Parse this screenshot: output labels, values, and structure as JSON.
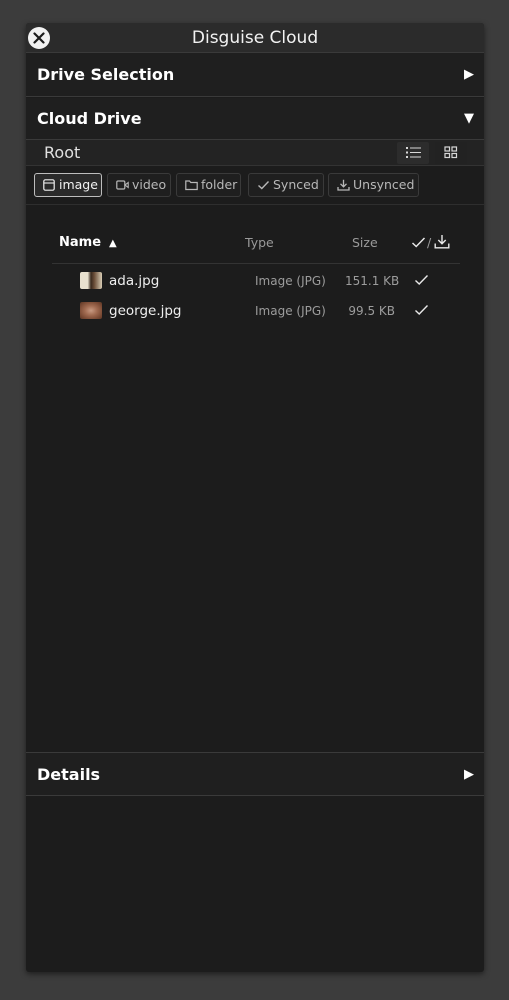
{
  "window": {
    "title": "Disguise Cloud",
    "close_icon": "close-icon"
  },
  "sections": {
    "drive_selection": {
      "label": "Drive Selection",
      "arrow": "▶",
      "state": "collapsed"
    },
    "cloud_drive": {
      "label": "Cloud Drive",
      "arrow": "▼",
      "state": "expanded"
    },
    "details": {
      "label": "Details",
      "arrow": "▶",
      "state": "collapsed"
    }
  },
  "breadcrumb": {
    "path": "Root",
    "selected_view": "list"
  },
  "view_buttons": [
    {
      "name": "list-view-icon"
    },
    {
      "name": "grid-view-icon"
    }
  ],
  "filters": [
    {
      "label": "image",
      "icon": "image-icon",
      "active": true
    },
    {
      "label": "video",
      "icon": "video-icon",
      "active": false
    },
    {
      "label": "folder",
      "icon": "folder-icon",
      "active": false
    },
    {
      "label": "Synced",
      "icon": "check-icon",
      "active": false
    },
    {
      "label": "Unsynced",
      "icon": "download-icon",
      "active": false
    }
  ],
  "table": {
    "headers": {
      "name": "Name",
      "sort": "▲",
      "type": "Type",
      "size": "Size",
      "sync_slash": "/"
    },
    "rows": [
      {
        "name": "ada.jpg",
        "type": "Image (JPG)",
        "size": "151.1 KB",
        "synced": true
      },
      {
        "name": "george.jpg",
        "type": "Image (JPG)",
        "size": "99.5 KB",
        "synced": true
      }
    ]
  },
  "colors": {
    "background": "#3c3c3c",
    "panel": "#1c1c1c",
    "titlebar": "#2b2b2b",
    "text": "#e6e6e6",
    "muted": "#9c9c9c"
  }
}
